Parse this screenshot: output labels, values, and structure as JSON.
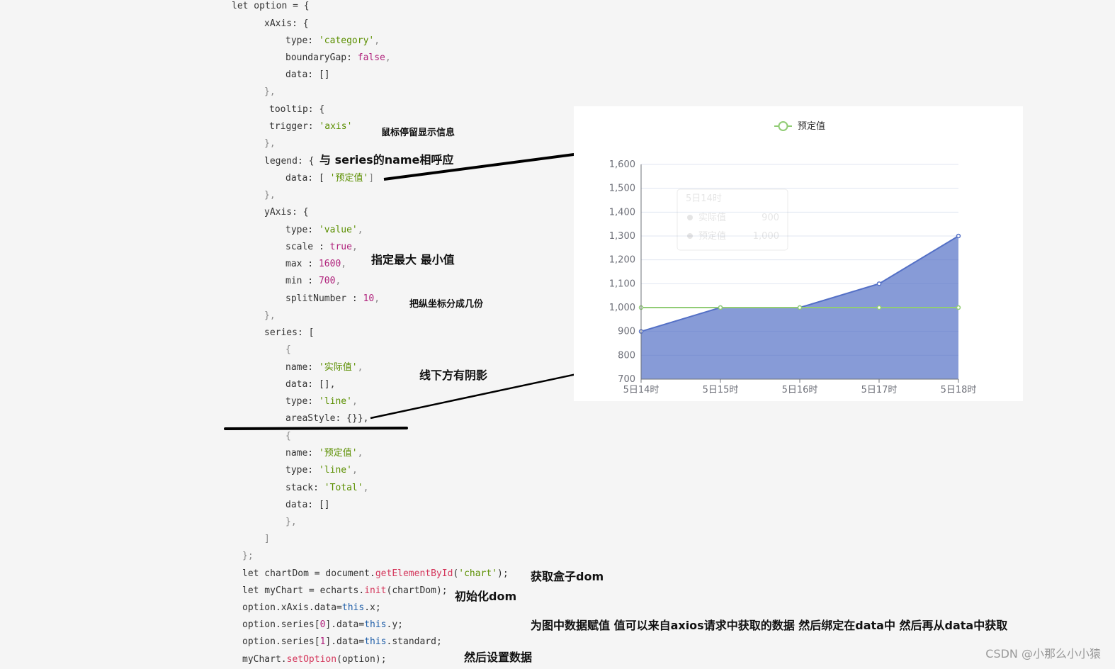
{
  "code": {
    "l1": [
      "let option = {"
    ],
    "l2": [
      "xAxis: {"
    ],
    "l3": [
      "type: ",
      "'category'",
      ","
    ],
    "l4": [
      "boundaryGap: ",
      "false",
      ","
    ],
    "l5": [
      "data: []"
    ],
    "l6": [
      "},"
    ],
    "l7": [
      "tooltip: {"
    ],
    "l8": [
      "trigger: ",
      "'axis'"
    ],
    "l9": [
      "},"
    ],
    "l10": [
      "legend: {"
    ],
    "l11": [
      "data: [ ",
      "'预定值'",
      "]"
    ],
    "l12": [
      "},"
    ],
    "l13": [
      "yAxis: {"
    ],
    "l14": [
      "type: ",
      "'value'",
      ","
    ],
    "l15": [
      "scale : ",
      "true",
      ","
    ],
    "l16": [
      "max : ",
      "1600",
      ","
    ],
    "l17": [
      "min : ",
      "700",
      ","
    ],
    "l18": [
      "splitNumber : ",
      "10",
      ","
    ],
    "l19": [
      "},"
    ],
    "l20": [
      "series: ["
    ],
    "l21": [
      "{"
    ],
    "l22": [
      "name: ",
      "'实际值'",
      ","
    ],
    "l23": [
      "data: [],"
    ],
    "l24": [
      "type: ",
      "'line'",
      ","
    ],
    "l25": [
      "areaStyle: {}},"
    ],
    "l26": [
      "{"
    ],
    "l27": [
      "name: ",
      "'预定值'",
      ","
    ],
    "l28": [
      "type: ",
      "'line'",
      ","
    ],
    "l29": [
      "stack: ",
      "'Total'",
      ","
    ],
    "l30": [
      "data: []"
    ],
    "l31": [
      "},"
    ],
    "l32": [
      "]"
    ],
    "l33": [
      "};"
    ],
    "l34": [
      "let chartDom = document.",
      "getElementById",
      "(",
      "'chart'",
      ");"
    ],
    "l35": [
      "let myChart = echarts.",
      "init",
      "(chartDom);"
    ],
    "l36": [
      "option.xAxis.data=",
      "this",
      ".x;"
    ],
    "l37": [
      "option.series[",
      "0",
      "].data=",
      "this",
      ".y;"
    ],
    "l38": [
      "option.series[",
      "1",
      "].data=",
      "this",
      ".standard;"
    ],
    "l39": [
      "myChart.",
      "setOption",
      "(option);"
    ]
  },
  "annotations": {
    "tooltip_note": "鼠标停留显示信息",
    "legend_note": "与 series的name相呼应",
    "minmax_note": "指定最大 最小值",
    "split_note": "把纵坐标分成几份",
    "area_note": "线下方有阴影",
    "dom_note": "获取盒子dom",
    "init_note": "初始化dom",
    "assign_note": "为图中数据赋值  值可以来自axios请求中获取的数据  然后绑定在data中 然后再从data中获取",
    "setopt_note": "然后设置数据"
  },
  "watermark": "CSDN @小那么小小猿",
  "chart_data": {
    "type": "line",
    "categories": [
      "5日14时",
      "5日15时",
      "5日16时",
      "5日17时",
      "5日18时"
    ],
    "series": [
      {
        "name": "实际值",
        "values": [
          900,
          1000,
          1000,
          1100,
          1300
        ],
        "color": "#5470c6",
        "area": true
      },
      {
        "name": "预定值",
        "values": [
          1000,
          1000,
          1000,
          1000,
          1000
        ],
        "color": "#91cc75",
        "area": false
      }
    ],
    "legend": [
      "预定值"
    ],
    "legend_position": "top-center",
    "ylim": [
      700,
      1600
    ],
    "yticks": [
      "700",
      "800",
      "900",
      "1,000",
      "1,100",
      "1,200",
      "1,300",
      "1,400",
      "1,500",
      "1,600"
    ],
    "grid": true,
    "tooltip_ghost": {
      "title": "5日14时",
      "rows": [
        [
          "实际值",
          "900"
        ],
        [
          "预定值",
          "1,000"
        ]
      ]
    }
  }
}
